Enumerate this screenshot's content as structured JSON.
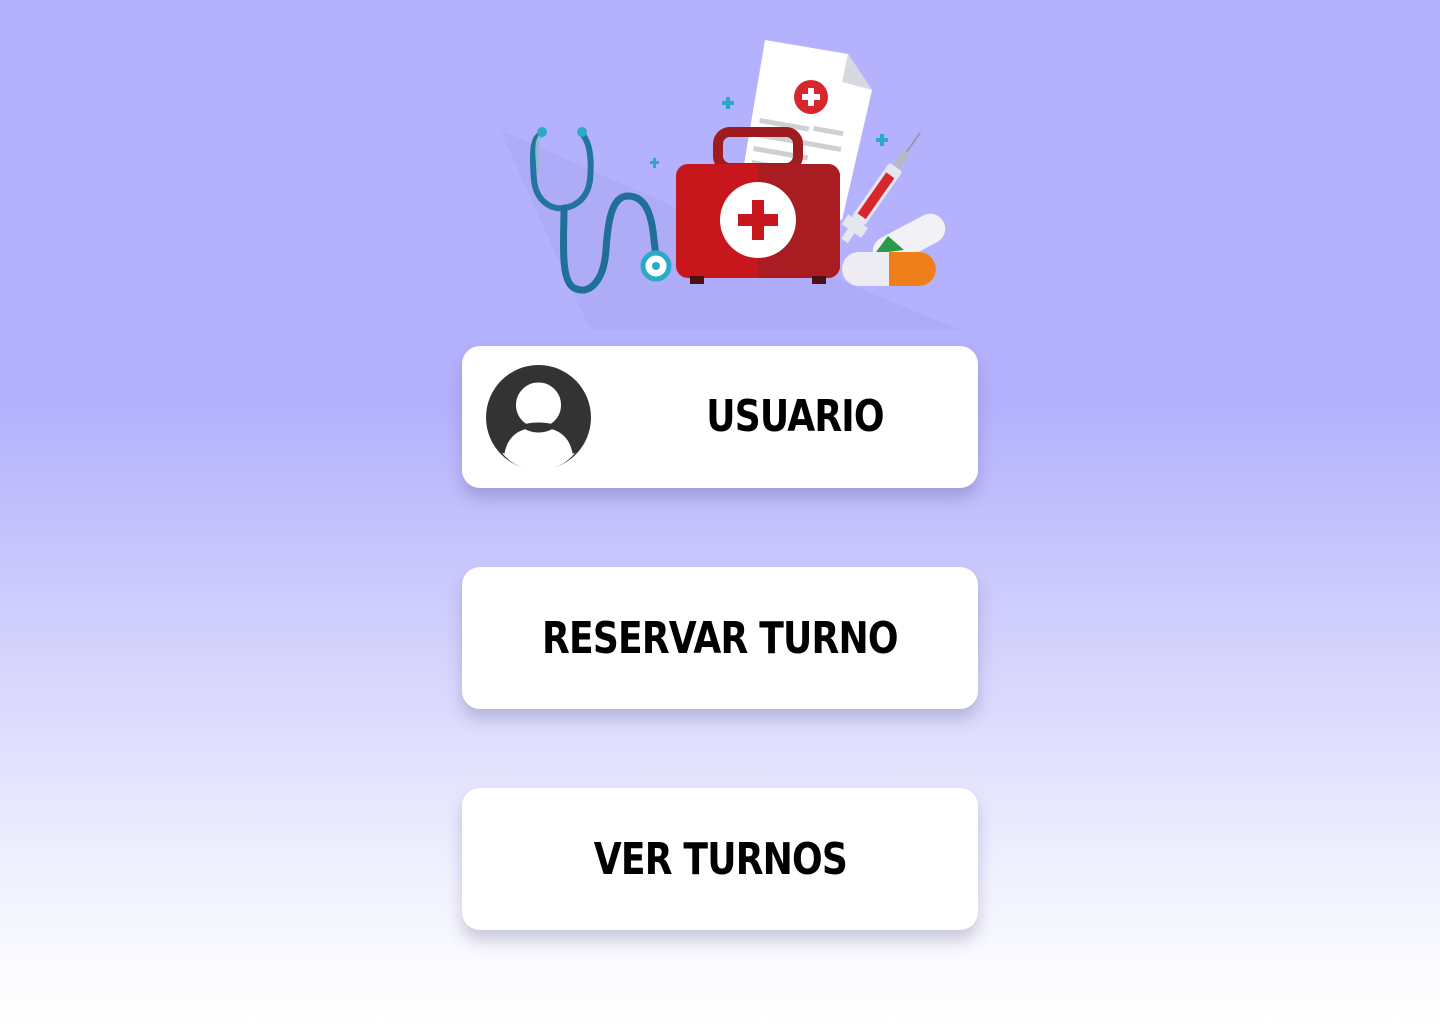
{
  "hero": {
    "illustration": "medical-kit-illustration"
  },
  "menu": {
    "usuario": {
      "label": "USUARIO",
      "icon": "user-avatar-icon"
    },
    "reservar": {
      "label": "RESERVAR TURNO"
    },
    "ver": {
      "label": "VER TURNOS"
    }
  },
  "colors": {
    "background_top": "#b4b2fd",
    "background_bottom": "#ffffff",
    "button_bg": "#ffffff",
    "text": "#000000",
    "kit_red": "#c8161d",
    "stethoscope_blue": "#1f6f98"
  }
}
